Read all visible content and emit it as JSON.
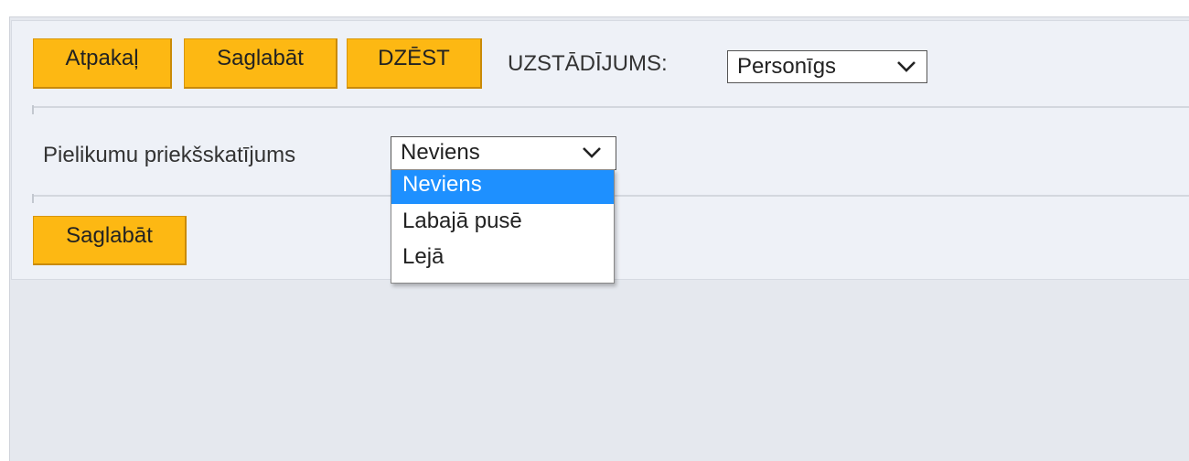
{
  "toolbar": {
    "back_label": "Atpakaļ",
    "save_label": "Saglabāt",
    "delete_label": "DZĒST",
    "setting_label": "UZSTĀDĪJUMS:",
    "setting_value": "Personīgs"
  },
  "preview": {
    "label": "Pielikumu priekšskatījums",
    "value": "Neviens",
    "options": [
      "Neviens",
      "Labajā pusē",
      "Lejā"
    ]
  },
  "footer": {
    "save_label": "Saglabāt"
  },
  "colors": {
    "button": "#fdb813",
    "selected_option": "#1e90ff",
    "panel": "#eef1f7",
    "background": "#e5e8ee"
  }
}
